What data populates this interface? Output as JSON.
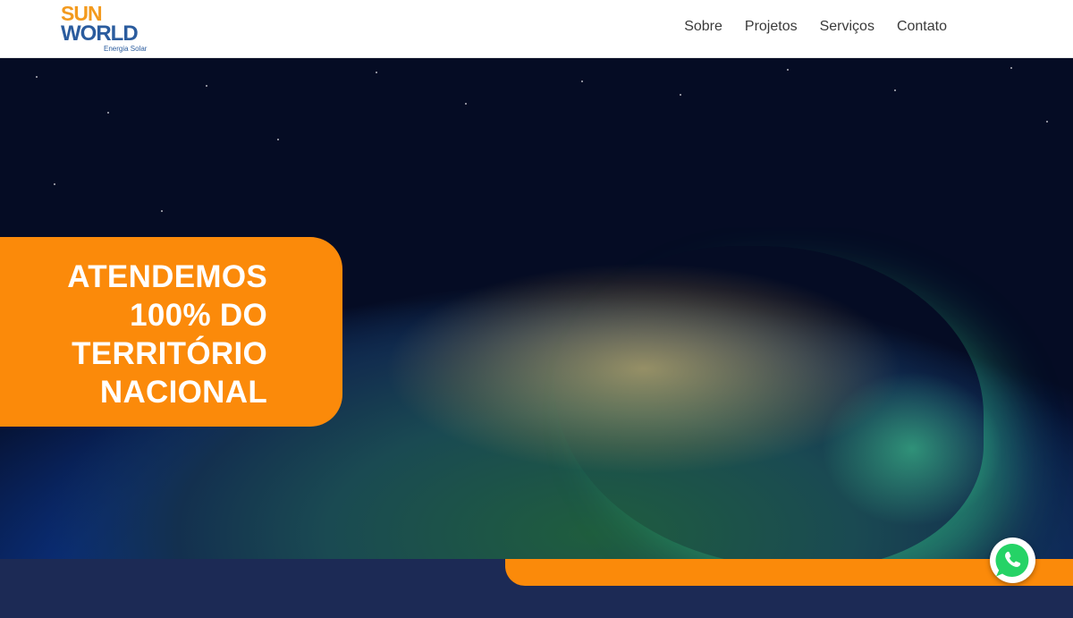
{
  "brand": {
    "logo_line1": "SUN",
    "logo_line2": "WORLD",
    "tagline": "Energia Solar",
    "primary_color": "#2b5c9e",
    "accent_color": "#f39a1e"
  },
  "nav": {
    "items": [
      {
        "label": "Sobre"
      },
      {
        "label": "Projetos"
      },
      {
        "label": "Serviços"
      },
      {
        "label": "Contato"
      }
    ]
  },
  "hero": {
    "callout_lines": [
      "ATENDEMOS",
      "100% DO",
      "TERRITÓRIO",
      "NACIONAL"
    ],
    "callout_color": "#fb8a0a"
  },
  "floating": {
    "whatsapp_icon": "whatsapp-icon",
    "whatsapp_color": "#25d366"
  }
}
